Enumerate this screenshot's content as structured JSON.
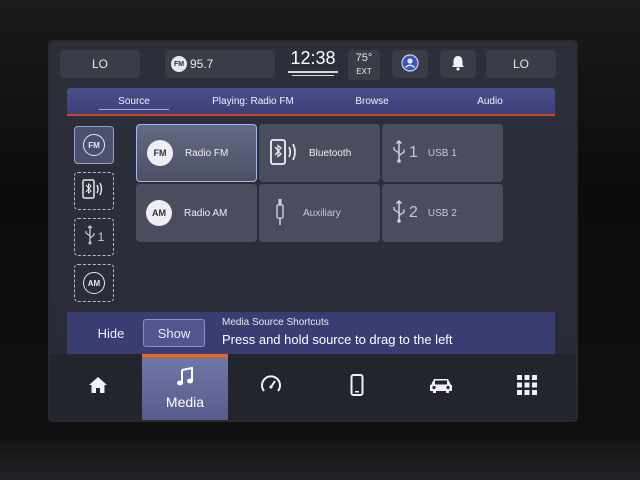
{
  "status": {
    "left_climate": "LO",
    "right_climate": "LO",
    "radio_badge": "FM",
    "radio_station": "95.7",
    "time": "12:38",
    "temp": "75°",
    "temp_label": "EXT"
  },
  "tabs": [
    {
      "label": "Source",
      "active": true
    },
    {
      "label": "Playing: Radio FM",
      "active": false
    },
    {
      "label": "Browse",
      "active": false
    },
    {
      "label": "Audio",
      "active": false
    }
  ],
  "shortcuts": [
    {
      "label": "FM",
      "icon": "radio-fm-icon"
    },
    {
      "label": "",
      "icon": "bluetooth-phone-icon"
    },
    {
      "label": "1",
      "icon": "usb-icon"
    },
    {
      "label": "AM",
      "icon": "radio-am-icon"
    }
  ],
  "sources": [
    {
      "label": "Radio FM",
      "badge": "FM",
      "icon": "radio-fm-icon",
      "selected": true
    },
    {
      "label": "Bluetooth",
      "icon": "bluetooth-phone-icon"
    },
    {
      "label": "USB 1",
      "num": "1",
      "icon": "usb-icon"
    },
    {
      "label": "Radio AM",
      "badge": "AM",
      "icon": "radio-am-icon"
    },
    {
      "label": "Auxiliary",
      "icon": "aux-icon"
    },
    {
      "label": "USB 2",
      "num": "2",
      "icon": "usb-icon"
    }
  ],
  "hint": {
    "hide_label": "Hide",
    "show_label": "Show",
    "title": "Media Source Shortcuts",
    "text": "Press and hold source to drag to the left"
  },
  "nav": {
    "media_label": "Media"
  },
  "colors": {
    "accent_orange": "#e06a2a",
    "tab_bar": "#444882",
    "selected_outline": "#a5b8e8"
  }
}
